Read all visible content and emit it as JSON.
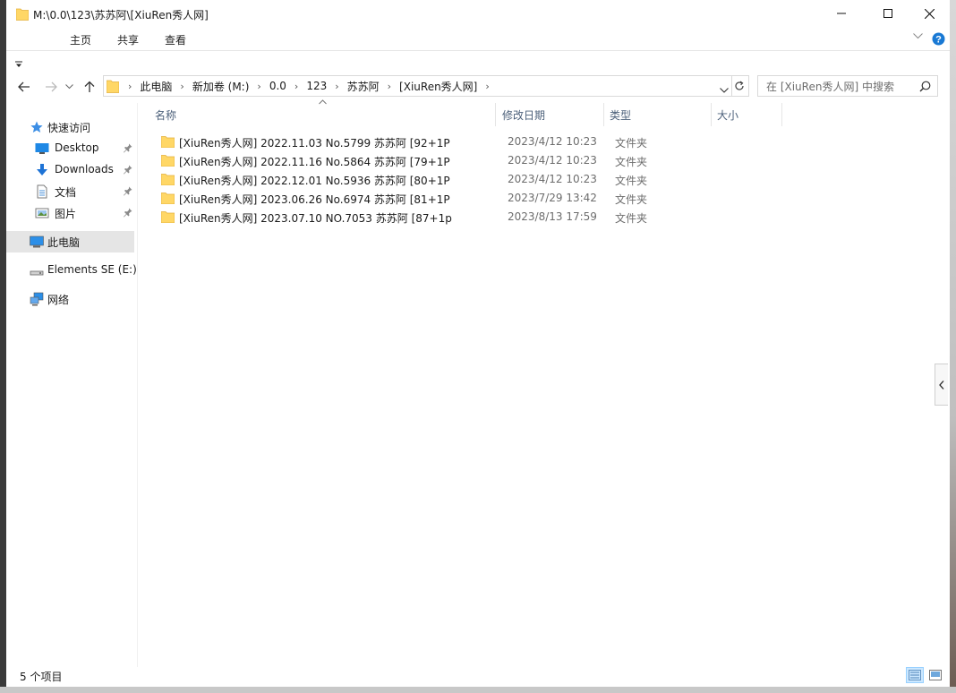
{
  "window": {
    "title": "M:\\0.0\\123\\苏苏阿\\[XiuRen秀人网]"
  },
  "ribbon": {
    "tabs": [
      "主页",
      "共享",
      "查看"
    ],
    "help_label": "?"
  },
  "address": {
    "crumbs": [
      "此电脑",
      "新加卷 (M:)",
      "0.0",
      "123",
      "苏苏阿",
      "[XiuRen秀人网]"
    ]
  },
  "search": {
    "placeholder": "在 [XiuRen秀人网] 中搜索"
  },
  "sidebar": {
    "items": [
      {
        "label": "快速访问",
        "icon": "star-icon",
        "pinned": false
      },
      {
        "label": "Desktop",
        "icon": "desktop-icon",
        "pinned": true
      },
      {
        "label": "Downloads",
        "icon": "download-icon",
        "pinned": true
      },
      {
        "label": "文档",
        "icon": "document-icon",
        "pinned": true
      },
      {
        "label": "图片",
        "icon": "picture-icon",
        "pinned": true
      },
      {
        "label": "此电脑",
        "icon": "computer-icon",
        "pinned": false,
        "selected": true
      },
      {
        "label": "Elements SE (E:)",
        "icon": "drive-icon",
        "pinned": false
      },
      {
        "label": "网络",
        "icon": "network-icon",
        "pinned": false
      }
    ]
  },
  "columns": {
    "name": "名称",
    "modified": "修改日期",
    "type": "类型",
    "size": "大小"
  },
  "files": [
    {
      "name": "[XiuRen秀人网] 2022.11.03 No.5799 苏苏阿 [92+1P",
      "modified": "2023/4/12 10:23",
      "type": "文件夹"
    },
    {
      "name": "[XiuRen秀人网] 2022.11.16 No.5864 苏苏阿 [79+1P",
      "modified": "2023/4/12 10:23",
      "type": "文件夹"
    },
    {
      "name": "[XiuRen秀人网] 2022.12.01 No.5936 苏苏阿 [80+1P",
      "modified": "2023/4/12 10:23",
      "type": "文件夹"
    },
    {
      "name": "[XiuRen秀人网] 2023.06.26 No.6974 苏苏阿 [81+1P",
      "modified": "2023/7/29 13:42",
      "type": "文件夹"
    },
    {
      "name": "[XiuRen秀人网] 2023.07.10 NO.7053 苏苏阿 [87+1p",
      "modified": "2023/8/13 17:59",
      "type": "文件夹"
    }
  ],
  "status": {
    "item_count": "5 个项目"
  },
  "colors": {
    "folder": "#ffd766",
    "accent": "#0078d7",
    "selection": "#e5e5e5"
  }
}
